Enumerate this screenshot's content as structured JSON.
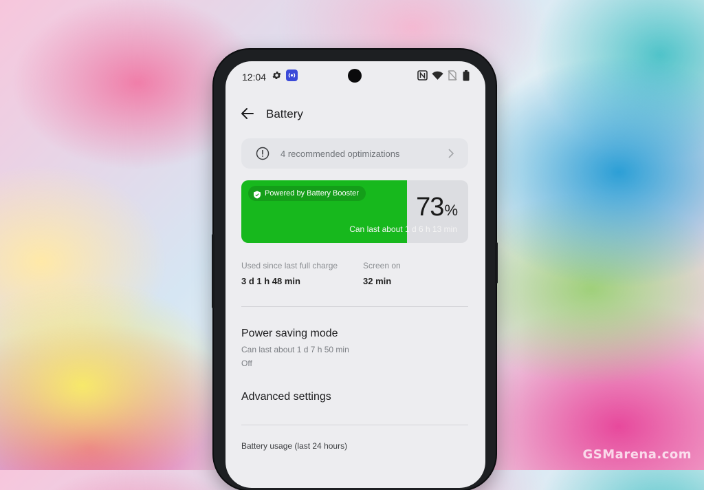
{
  "status_bar": {
    "time": "12:04",
    "icons": [
      "gear-icon",
      "nfc-broadcast-icon",
      "nfc-icon",
      "wifi-icon",
      "no-sim-icon",
      "battery-icon"
    ]
  },
  "header": {
    "title": "Battery"
  },
  "optimizations": {
    "label": "4 recommended optimizations"
  },
  "battery": {
    "level_percent": 73,
    "percent_value": "73",
    "percent_sign": "%",
    "booster_label": "Powered by Battery Booster",
    "remaining": "Can last about 1 d 6 h 13 min",
    "fill_color": "#17b81d"
  },
  "usage": {
    "since_charge_label": "Used since last full charge",
    "since_charge_value": "3 d 1 h 48 min",
    "screen_on_label": "Screen on",
    "screen_on_value": "32 min"
  },
  "power_saving": {
    "title": "Power saving mode",
    "subtitle": "Can last about 1 d 7 h 50 min",
    "state": "Off"
  },
  "advanced": {
    "title": "Advanced settings"
  },
  "battery_usage": {
    "label": "Battery usage (last 24 hours)"
  },
  "watermark": "GSMarena.com"
}
